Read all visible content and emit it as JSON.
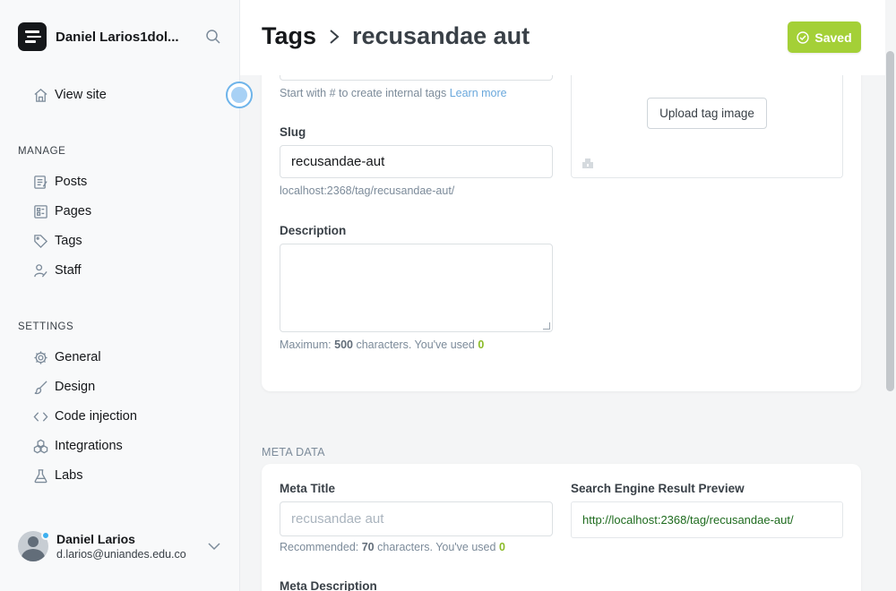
{
  "sidebar": {
    "site_name": "Daniel Larios1dol...",
    "view_site": "View site",
    "manage_heading": "MANAGE",
    "manage_items": [
      {
        "label": "Posts",
        "icon": "posts-icon"
      },
      {
        "label": "Pages",
        "icon": "pages-icon"
      },
      {
        "label": "Tags",
        "icon": "tag-icon"
      },
      {
        "label": "Staff",
        "icon": "staff-icon"
      }
    ],
    "settings_heading": "SETTINGS",
    "settings_items": [
      {
        "label": "General",
        "icon": "gear-icon"
      },
      {
        "label": "Design",
        "icon": "brush-icon"
      },
      {
        "label": "Code injection",
        "icon": "code-icon"
      },
      {
        "label": "Integrations",
        "icon": "integrations-icon"
      },
      {
        "label": "Labs",
        "icon": "flask-icon"
      }
    ],
    "user": {
      "name": "Daniel Larios",
      "email": "d.larios@uniandes.edu.co"
    }
  },
  "header": {
    "breadcrumb_parent": "Tags",
    "breadcrumb_current": "recusandae aut",
    "saved_label": "Saved"
  },
  "form": {
    "name_hint": "Start with # to create internal tags",
    "name_hint_link": "Learn more",
    "upload_label": "Upload tag image",
    "slug_label": "Slug",
    "slug_value": "recusandae-aut",
    "slug_url": "localhost:2368/tag/recusandae-aut/",
    "description_label": "Description",
    "description_hint_prefix": "Maximum:",
    "description_max": "500",
    "description_hint_mid": "characters. You've used",
    "description_used": "0"
  },
  "meta": {
    "section_title": "META DATA",
    "title_label": "Meta Title",
    "title_placeholder": "recusandae aut",
    "title_hint_prefix": "Recommended:",
    "title_recommended": "70",
    "title_hint_mid": "characters. You've used",
    "title_used": "0",
    "preview_label": "Search Engine Result Preview",
    "preview_url": "http://localhost:2368/tag/recusandae-aut/",
    "description_label": "Meta Description"
  },
  "colors": {
    "accent_green": "#a4d037",
    "link_blue": "#6aa8dc",
    "serp_green": "#1e6b1e"
  }
}
